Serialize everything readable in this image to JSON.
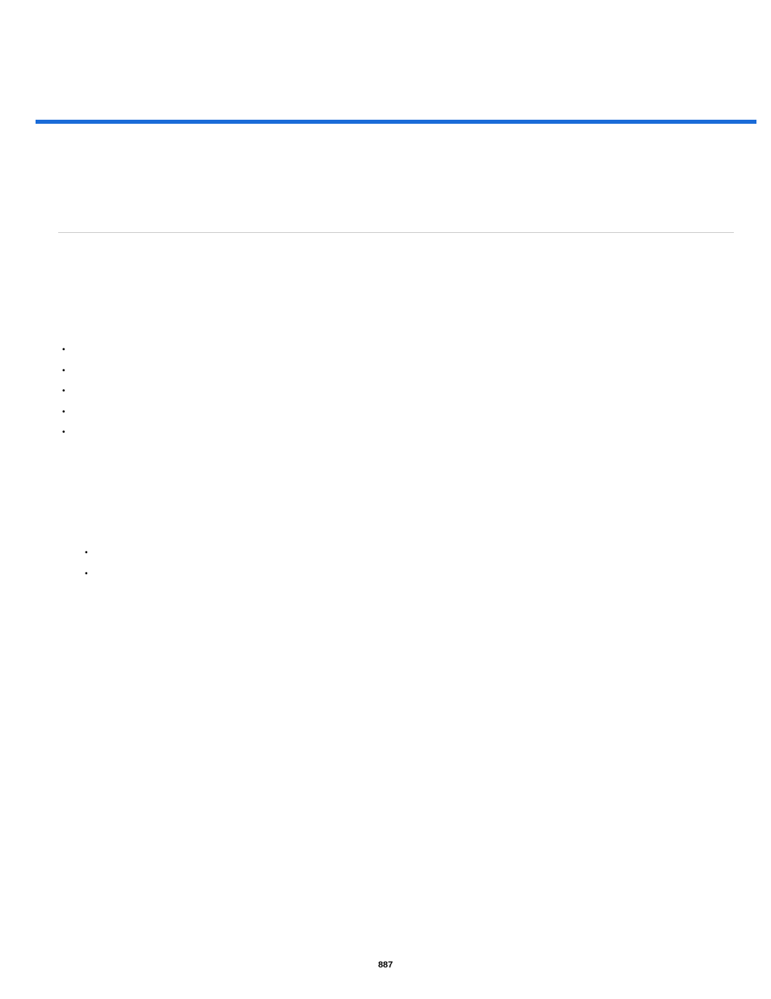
{
  "page_number": "887",
  "accent_color": "#1a6bd8",
  "bullet_group_1": [
    "",
    "",
    "",
    "",
    ""
  ],
  "bullet_group_2": [
    "",
    ""
  ]
}
